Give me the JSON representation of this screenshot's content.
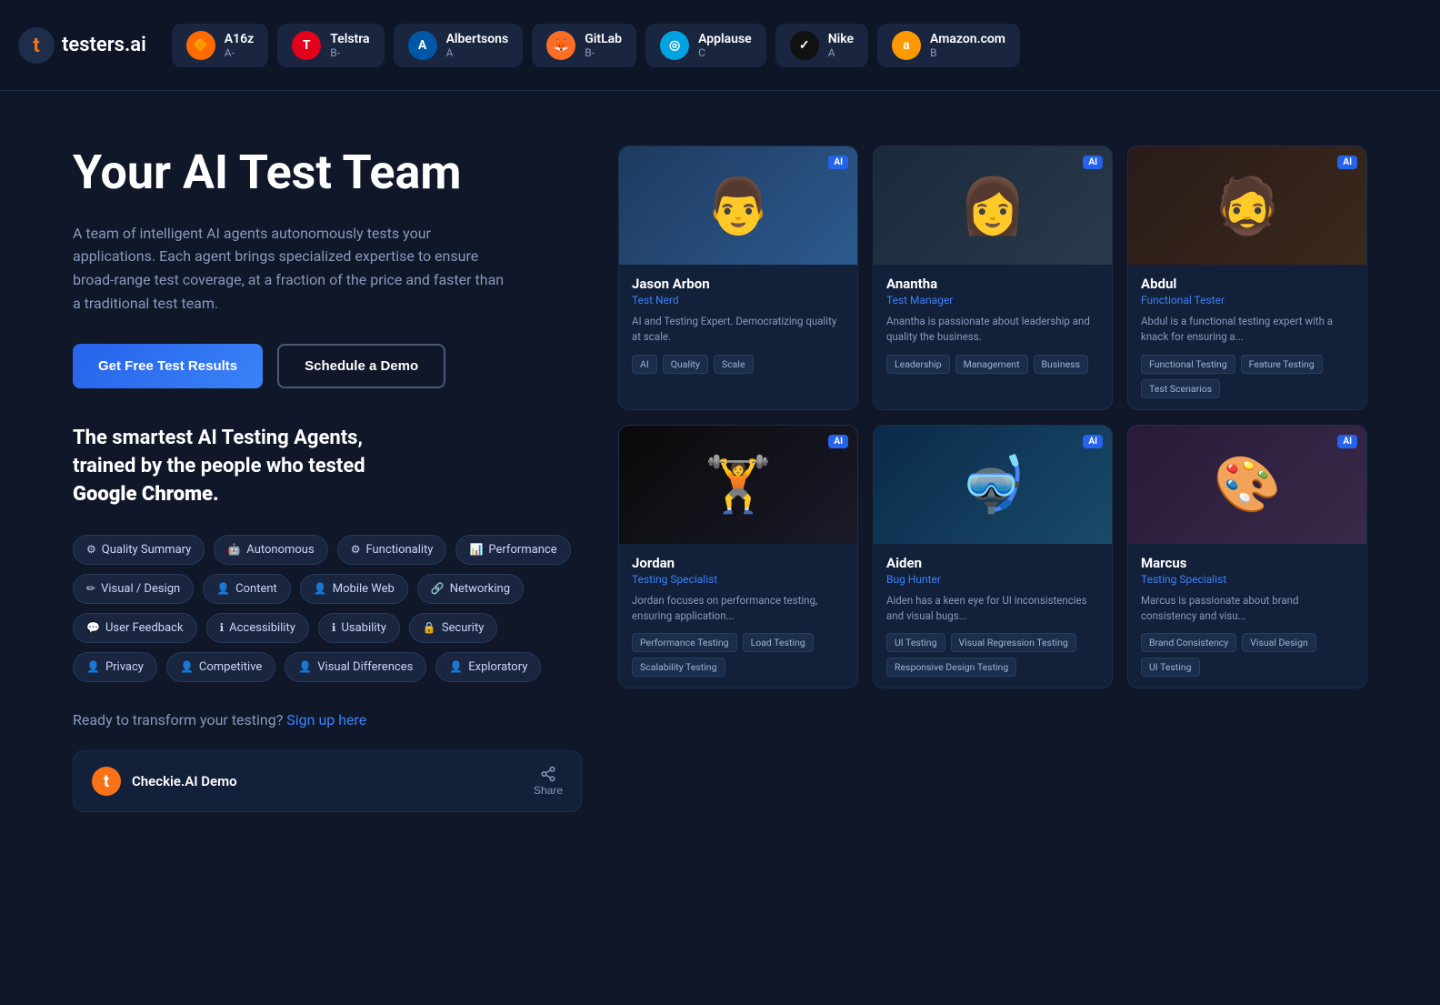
{
  "navbar": {
    "logo_text": "testers.ai",
    "companies": [
      {
        "name": "A16z",
        "grade": "A-",
        "icon": "🔶",
        "bg": "#ff6b00"
      },
      {
        "name": "Telstra",
        "grade": "B-",
        "icon": "T",
        "bg": "#e2001a"
      },
      {
        "name": "Albertsons",
        "grade": "A",
        "icon": "A",
        "bg": "#0057a6"
      },
      {
        "name": "GitLab",
        "grade": "B-",
        "icon": "🦊",
        "bg": "#fc6d26"
      },
      {
        "name": "Applause",
        "grade": "C",
        "icon": "◎",
        "bg": "#00a3e0"
      },
      {
        "name": "Nike",
        "grade": "A",
        "icon": "✓",
        "bg": "#111111"
      },
      {
        "name": "Amazon.com",
        "grade": "B",
        "icon": "a",
        "bg": "#ff9900"
      }
    ]
  },
  "hero": {
    "title": "Your AI Test Team",
    "description": "A team of intelligent AI agents autonomously tests your applications. Each agent brings specialized expertise to ensure broad-range test coverage, at a fraction of the price and faster than a traditional test team.",
    "btn_primary": "Get Free Test Results",
    "btn_secondary": "Schedule a Demo",
    "tagline_line1": "The smartest AI Testing Agents,",
    "tagline_line2": "trained by the people who tested",
    "tagline_line3": "Google Chrome.",
    "cta_text": "Ready to transform your testing?",
    "cta_link": "Sign up here"
  },
  "tags": [
    {
      "label": "Quality Summary",
      "icon": "⚙"
    },
    {
      "label": "Autonomous",
      "icon": "🤖"
    },
    {
      "label": "Functionality",
      "icon": "⚙"
    },
    {
      "label": "Performance",
      "icon": "📊"
    },
    {
      "label": "Visual / Design",
      "icon": "✏"
    },
    {
      "label": "Content",
      "icon": "👤"
    },
    {
      "label": "Mobile Web",
      "icon": "👤"
    },
    {
      "label": "Networking",
      "icon": "🔗"
    },
    {
      "label": "User Feedback",
      "icon": "💬"
    },
    {
      "label": "Accessibility",
      "icon": "ℹ"
    },
    {
      "label": "Usability",
      "icon": "ℹ"
    },
    {
      "label": "Security",
      "icon": "🔒"
    },
    {
      "label": "Privacy",
      "icon": "👤"
    },
    {
      "label": "Competitive",
      "icon": "👤"
    },
    {
      "label": "Visual Differences",
      "icon": "👤"
    },
    {
      "label": "Exploratory",
      "icon": "👤"
    }
  ],
  "video": {
    "title": "Checkie.AI Demo",
    "share_label": "Share"
  },
  "agents": [
    {
      "name": "Jason Arbon",
      "role": "Test Nerd",
      "desc": "AI and Testing Expert. Democratizing quality at scale.",
      "tags": [
        "AI",
        "Quality",
        "Scale"
      ],
      "avatar_color": "av-blue",
      "avatar_emoji": "👨"
    },
    {
      "name": "Anantha",
      "role": "Test Manager",
      "desc": "Anantha is passionate about leadership and quality the business.",
      "tags": [
        "Leadership",
        "Management",
        "Business"
      ],
      "avatar_color": "av-dark",
      "avatar_emoji": "👩"
    },
    {
      "name": "Abdul",
      "role": "Functional Tester",
      "desc": "Abdul is a functional testing expert with a knack for ensuring a...",
      "tags": [
        "Functional Testing",
        "Feature Testing",
        "Test Scenarios"
      ],
      "avatar_color": "av-warm",
      "avatar_emoji": "🧔"
    },
    {
      "name": "Jordan",
      "role": "Testing Specialist",
      "desc": "Jordan focuses on performance testing, ensuring application...",
      "tags": [
        "Performance Testing",
        "Load Testing",
        "Scalability Testing"
      ],
      "avatar_color": "av-black",
      "avatar_emoji": "🏋"
    },
    {
      "name": "Aiden",
      "role": "Bug Hunter",
      "desc": "Aiden has a keen eye for UI inconsistencies and visual bugs...",
      "tags": [
        "UI Testing",
        "Visual Regression Testing",
        "Responsive Design Testing"
      ],
      "avatar_color": "av-ocean",
      "avatar_emoji": "🤿"
    },
    {
      "name": "Marcus",
      "role": "Testing Specialist",
      "desc": "Marcus is passionate about brand consistency and visu...",
      "tags": [
        "Brand Consistency",
        "Visual Design",
        "UI Testing"
      ],
      "avatar_color": "av-art",
      "avatar_emoji": "🎨"
    }
  ],
  "bottom_agents_partial": true
}
